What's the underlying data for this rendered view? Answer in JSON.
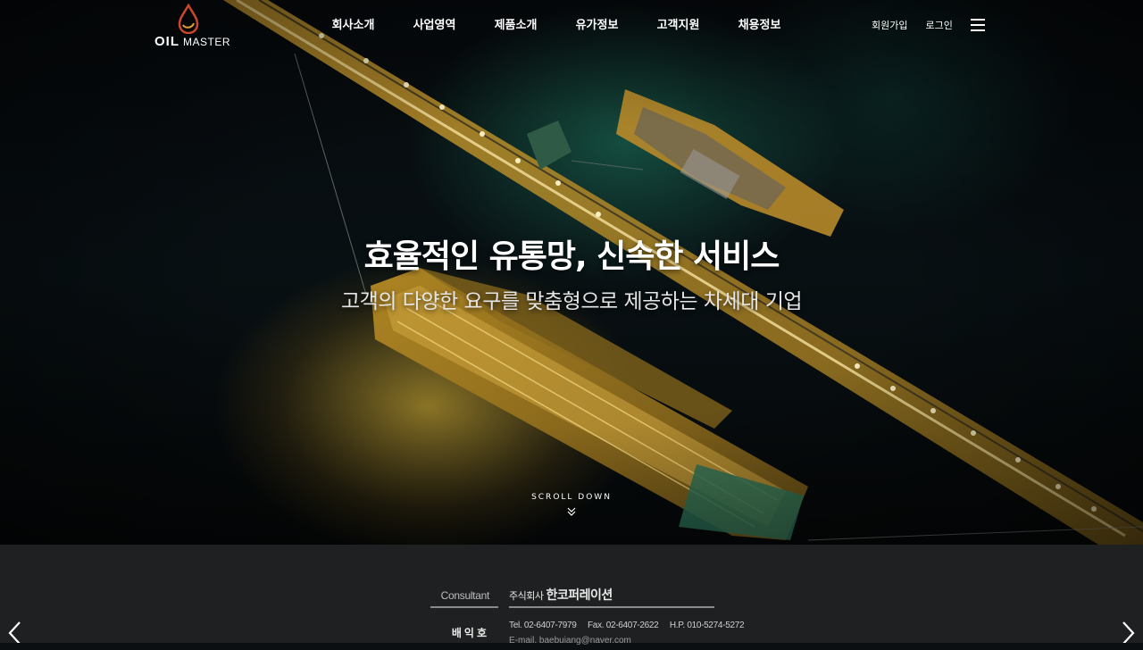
{
  "brand": {
    "logo_word1": "OIL",
    "logo_word2": "MASTER"
  },
  "nav": {
    "items": [
      "회사소개",
      "사업영역",
      "제품소개",
      "유가정보",
      "고객지원",
      "채용정보"
    ]
  },
  "util": {
    "signup": "회원가입",
    "login": "로그인",
    "menu_icon": "hamburger-icon"
  },
  "hero": {
    "title": "효율적인 유통망, 신속한 서비스",
    "subtitle": "고객의 다양한 요구를 맞춤형으로 제공하는 차세대 기업",
    "scroll_label": "SCROLL DOWN",
    "scroll_icon": "double-chevron-down-icon"
  },
  "card": {
    "consultant_label": "Consultant",
    "company_prefix": "주식회사",
    "company_name": "한코퍼레이션",
    "person_name": "배익호",
    "tel": "Tel. 02-6407-7979",
    "fax": "Fax. 02-6407-2622",
    "hp": "H.P. 010-5274-5272",
    "email": "E-mail. baebuiang@naver.com"
  },
  "colors": {
    "footer_bg": "#1f2021",
    "text_primary": "#ffffff"
  }
}
